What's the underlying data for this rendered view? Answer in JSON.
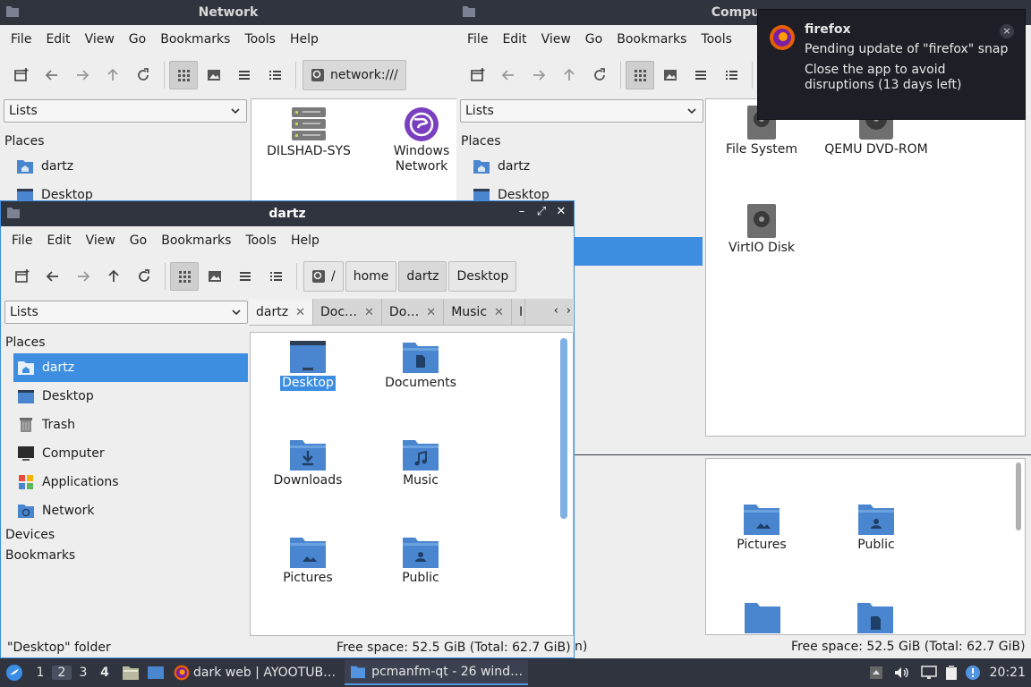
{
  "menu": [
    "File",
    "Edit",
    "View",
    "Go",
    "Bookmarks",
    "Tools",
    "Help"
  ],
  "network_window": {
    "title": "Network",
    "path": "network:///",
    "side_combo": "Lists",
    "places_header": "Places",
    "places": [
      "dartz",
      "Desktop"
    ],
    "items": [
      "DILSHAD-SYS",
      "Windows Network"
    ]
  },
  "computer_window": {
    "title": "Compu",
    "side_combo": "Lists",
    "places_header": "Places",
    "places": [
      "dartz",
      "Desktop"
    ],
    "items": [
      "File System",
      "QEMU DVD-ROM",
      "VirtIO Disk"
    ],
    "lower_items": [
      "Pictures",
      "Public"
    ],
    "status_left": "n)",
    "free_space": "Free space: 52.5 GiB (Total: 62.7 GiB)"
  },
  "dartz_window": {
    "title": "dartz",
    "title_buttons": [
      "–",
      "⤢",
      "✕"
    ],
    "breadcrumb": [
      "/",
      "home",
      "dartz",
      "Desktop"
    ],
    "side_combo": "Lists",
    "places_header": "Places",
    "places": [
      "dartz",
      "Desktop",
      "Trash",
      "Computer",
      "Applications",
      "Network"
    ],
    "devices_header": "Devices",
    "bookmarks_header": "Bookmarks",
    "tabs": [
      "dartz",
      "Doc…",
      "Do…",
      "Music",
      "I"
    ],
    "items": [
      "Desktop",
      "Documents",
      "Downloads",
      "Music",
      "Pictures",
      "Public"
    ],
    "status_left": "\"Desktop\" folder",
    "free_space": "Free space: 52.5 GiB (Total: 62.7 GiB)"
  },
  "notification": {
    "app": "firefox",
    "line1": "Pending update of \"firefox\" snap",
    "line2": "Close the app to avoid disruptions (13 days left)",
    "close": "×"
  },
  "taskbar": {
    "workspaces": [
      "1",
      "2",
      "3",
      "4"
    ],
    "task_firefox": "dark web | AYOOTUB…",
    "task_files": "pcmanfm-qt - 26 wind…",
    "clock": "20:21"
  },
  "colors": {
    "accent": "#3d8ee0",
    "folder": "#4a86cf",
    "panel": "#2f343f"
  }
}
